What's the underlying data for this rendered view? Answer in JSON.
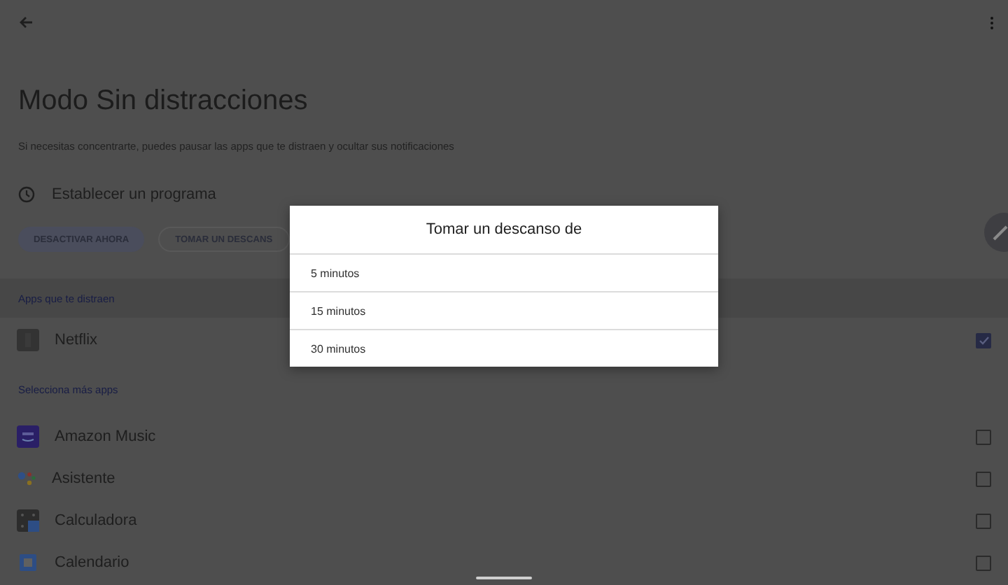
{
  "title": "Modo Sin distracciones",
  "description": "Si necesitas concentrarte, puedes pausar las apps que te distraen y ocultar sus notificaciones",
  "schedule": {
    "label": "Establecer un programa"
  },
  "actions": [
    {
      "label": "DESACTIVAR AHORA",
      "kind": "filled"
    },
    {
      "label": "TOMAR UN DESCANS",
      "kind": "outlined"
    }
  ],
  "sections": [
    {
      "heading": "Apps que te distraen",
      "apps": [
        {
          "name": "Netflix",
          "kind": "tile",
          "checked": true
        }
      ]
    },
    {
      "heading": "Selecciona más apps",
      "apps": [
        {
          "name": "Amazon Music",
          "kind": "music",
          "checked": false
        },
        {
          "name": "Asistente",
          "kind": "assistant",
          "checked": false
        },
        {
          "name": "Calculadora",
          "kind": "calculator",
          "checked": false
        },
        {
          "name": "Calendario",
          "kind": "calendar",
          "checked": false
        }
      ]
    }
  ],
  "dialog": {
    "title": "Tomar un descanso de",
    "options": [
      "5 minutos",
      "15 minutos",
      "30 minutos"
    ]
  }
}
